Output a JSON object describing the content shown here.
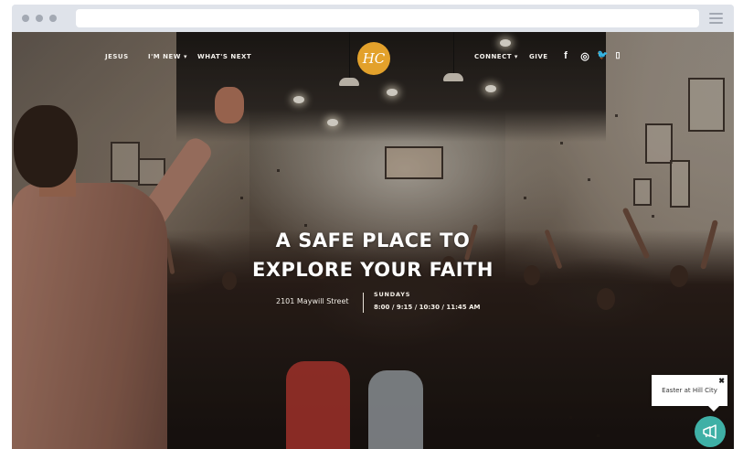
{
  "browser": {
    "url": "",
    "menu_icon": "hamburger-menu-icon"
  },
  "nav": {
    "left_items": [
      {
        "label": "JESUS"
      },
      {
        "label": "I'M NEW ▾"
      },
      {
        "label": "WHAT'S NEXT"
      }
    ],
    "logo_text": "HC",
    "right_items": [
      {
        "label": "CONNECT ▾"
      },
      {
        "label": "GIVE"
      }
    ],
    "social": [
      {
        "icon": "facebook-icon",
        "glyph": "f"
      },
      {
        "icon": "instagram-icon",
        "glyph": "◎"
      },
      {
        "icon": "twitter-icon",
        "glyph": "🐦"
      },
      {
        "icon": "mobile-icon",
        "glyph": "▯"
      }
    ]
  },
  "hero": {
    "headline_line1": "A SAFE PLACE TO",
    "headline_line2": "EXPLORE YOUR FAITH",
    "address": "2101 Maywill Street",
    "service_label": "SUNDAYS",
    "service_times": "8:00 / 9:15 / 10:30 / 11:45 AM"
  },
  "popup": {
    "text": "Easter at Hill City",
    "close": "✖"
  },
  "colors": {
    "logo": "#e3a12b",
    "chat_button": "#3fb0a6"
  }
}
